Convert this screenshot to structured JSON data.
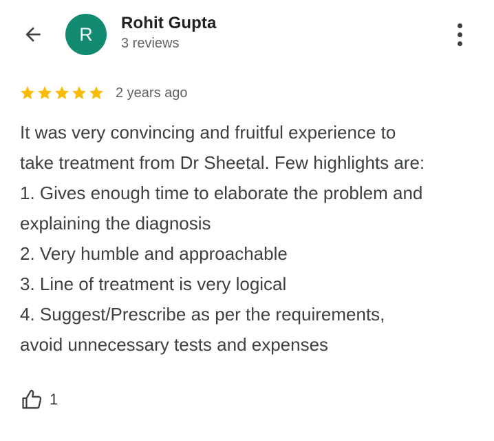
{
  "colors": {
    "avatar_bg": "#128a72",
    "star": "#f9bc05",
    "text": "#3c4043",
    "secondary_text": "#5f6368"
  },
  "header": {
    "back_icon": "arrow-back-icon",
    "avatar_initial": "R",
    "author_name": "Rohit Gupta",
    "review_count": "3 reviews",
    "more_icon": "more-vertical-icon"
  },
  "review": {
    "rating": 5,
    "rating_max": 5,
    "date": "2 years ago",
    "text_lines": [
      "It was very convincing and fruitful experience to",
      "take treatment from Dr Sheetal. Few highlights are:",
      "1. Gives enough time to elaborate the problem and",
      "explaining the diagnosis",
      "2. Very humble and approachable",
      "3. Line of treatment is very logical",
      "4. Suggest/Prescribe as per the requirements,",
      "avoid unnecessary tests and expenses"
    ]
  },
  "actions": {
    "like_icon": "thumbs-up-icon",
    "like_count": "1"
  }
}
